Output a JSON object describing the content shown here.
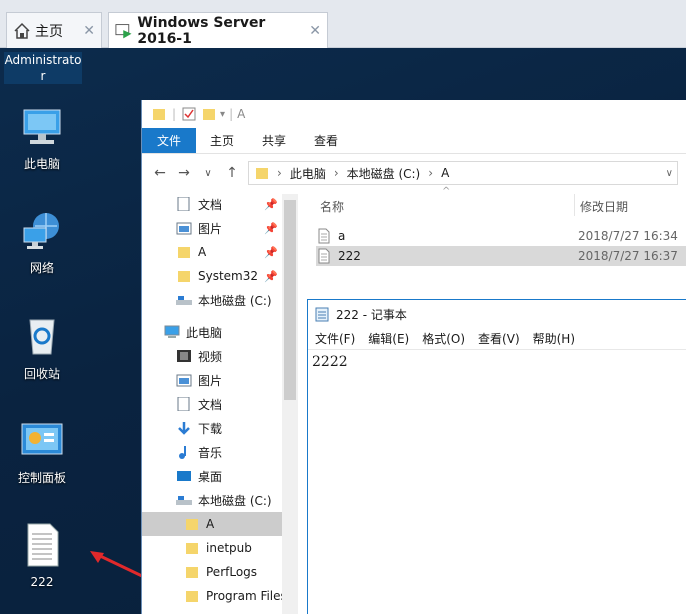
{
  "tabs": [
    {
      "label": "主页",
      "close": "✕"
    },
    {
      "label": "Windows Server 2016-1",
      "close": "✕"
    }
  ],
  "desktop": {
    "user_label_1": "Administrato",
    "user_label_2": "r",
    "icons": [
      "此电脑",
      "网络",
      "回收站",
      "控制面板",
      "222"
    ]
  },
  "explorer": {
    "qat_path": "A",
    "ribbon_tabs": [
      "文件",
      "主页",
      "共享",
      "查看"
    ],
    "breadcrumb": [
      "此电脑",
      "本地磁盘 (C:)",
      "A"
    ],
    "nav_items": [
      "文档",
      "图片",
      "A",
      "System32",
      "本地磁盘 (C:)",
      "此电脑",
      "视频",
      "图片",
      "文档",
      "下载",
      "音乐",
      "桌面",
      "本地磁盘 (C:)",
      "A",
      "inetpub",
      "PerfLogs",
      "Program Files"
    ],
    "columns": {
      "name": "名称",
      "date": "修改日期"
    },
    "files": [
      {
        "name": "a",
        "date": "2018/7/27 16:34"
      },
      {
        "name": "222",
        "date": "2018/7/27 16:37"
      }
    ]
  },
  "notepad": {
    "title": "222 - 记事本",
    "menu": [
      "文件(F)",
      "编辑(E)",
      "格式(O)",
      "查看(V)",
      "帮助(H)"
    ],
    "content": "2222"
  },
  "colors": {
    "accent": "#1979ca",
    "desktop_bg": "#0b2a4a",
    "arrow": "#e0292b"
  }
}
